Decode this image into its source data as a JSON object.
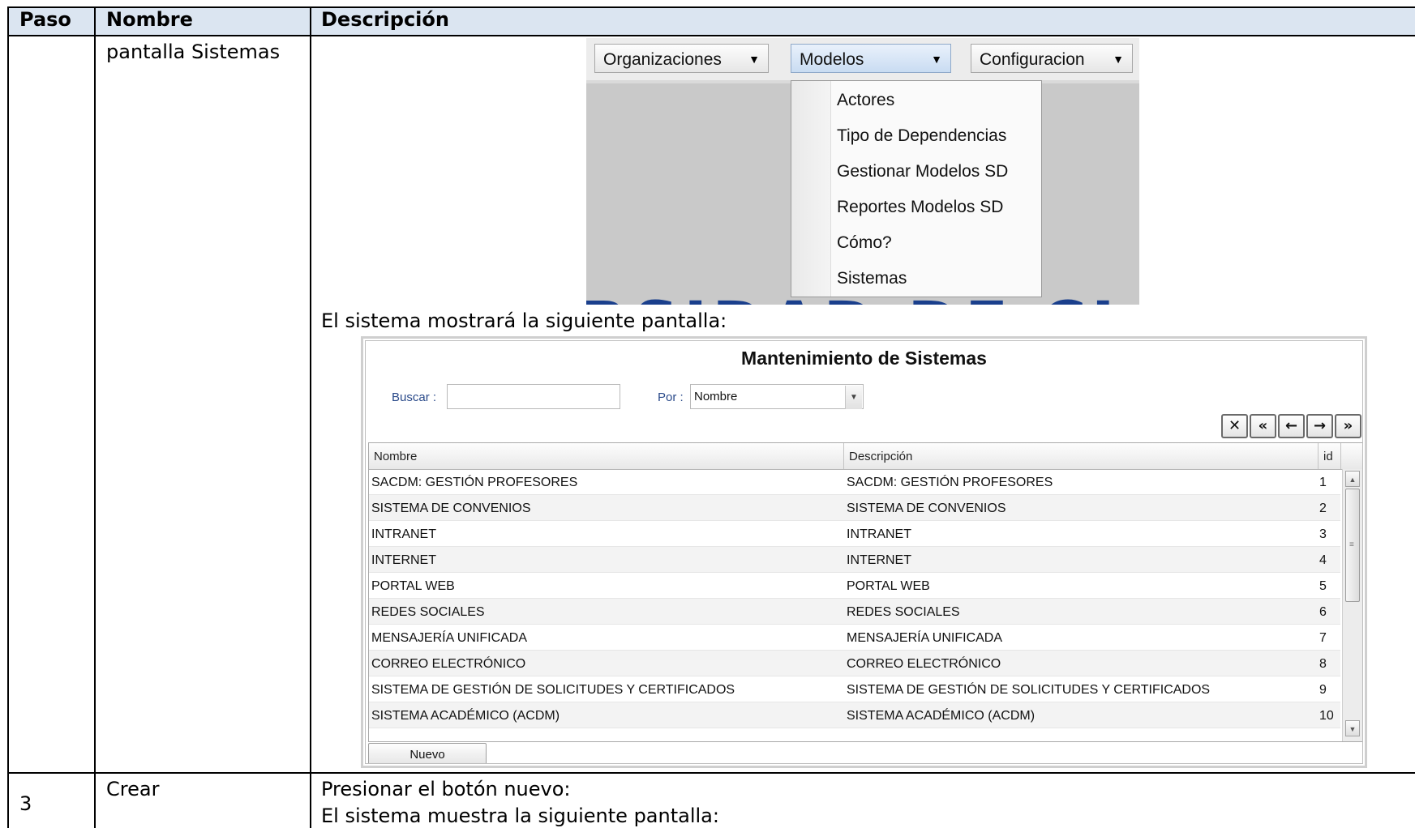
{
  "table": {
    "headers": [
      "Paso",
      "Nombre",
      "Descripción"
    ],
    "rows": [
      {
        "paso": "",
        "nombre": "pantalla Sistemas",
        "descripcion_text": "El sistema mostrará la siguiente pantalla:"
      },
      {
        "paso": "3",
        "nombre": "Crear",
        "descripcion_line1": "Presionar el botón nuevo:",
        "descripcion_line2": "El sistema muestra la siguiente pantalla:"
      }
    ],
    "header_bg": "#dbe5f1"
  },
  "menu_screenshot": {
    "menus": [
      {
        "label": "Organizaciones",
        "active": false
      },
      {
        "label": "Modelos",
        "active": true
      },
      {
        "label": "Configuracion",
        "active": false
      }
    ],
    "dropdown_items": [
      "Actores",
      "Tipo de Dependencias",
      "Gestionar Modelos SD",
      "Reportes Modelos SD",
      "Cómo?",
      "Sistemas"
    ],
    "caret_icon": "triangle-down-icon"
  },
  "app_screenshot": {
    "title": "Mantenimiento de Sistemas",
    "search": {
      "label": "Buscar :",
      "value": ""
    },
    "filter": {
      "label": "Por :",
      "selected": "Nombre"
    },
    "pager_icons": [
      "close-icon",
      "first-page-icon",
      "previous-page-icon",
      "next-page-icon",
      "last-page-icon"
    ],
    "columns": [
      "Nombre",
      "Descripción",
      "id"
    ],
    "rows": [
      {
        "nombre": "SACDM: GESTIÓN PROFESORES",
        "descripcion": "SACDM: GESTIÓN PROFESORES",
        "id": "1"
      },
      {
        "nombre": "SISTEMA DE CONVENIOS",
        "descripcion": "SISTEMA DE CONVENIOS",
        "id": "2"
      },
      {
        "nombre": "INTRANET",
        "descripcion": "INTRANET",
        "id": "3"
      },
      {
        "nombre": "INTERNET",
        "descripcion": "INTERNET",
        "id": "4"
      },
      {
        "nombre": "PORTAL WEB",
        "descripcion": "PORTAL WEB",
        "id": "5"
      },
      {
        "nombre": "REDES SOCIALES",
        "descripcion": "REDES SOCIALES",
        "id": "6"
      },
      {
        "nombre": "MENSAJERÍA UNIFICADA",
        "descripcion": "MENSAJERÍA UNIFICADA",
        "id": "7"
      },
      {
        "nombre": "CORREO ELECTRÓNICO",
        "descripcion": "CORREO ELECTRÓNICO",
        "id": "8"
      },
      {
        "nombre": "SISTEMA DE GESTIÓN DE SOLICITUDES Y CERTIFICADOS",
        "descripcion": "SISTEMA DE GESTIÓN DE SOLICITUDES Y CERTIFICADOS",
        "id": "9"
      },
      {
        "nombre": "SISTEMA ACADÉMICO (ACDM)",
        "descripcion": "SISTEMA ACADÉMICO (ACDM)",
        "id": "10"
      }
    ],
    "new_button": "Nuevo"
  }
}
